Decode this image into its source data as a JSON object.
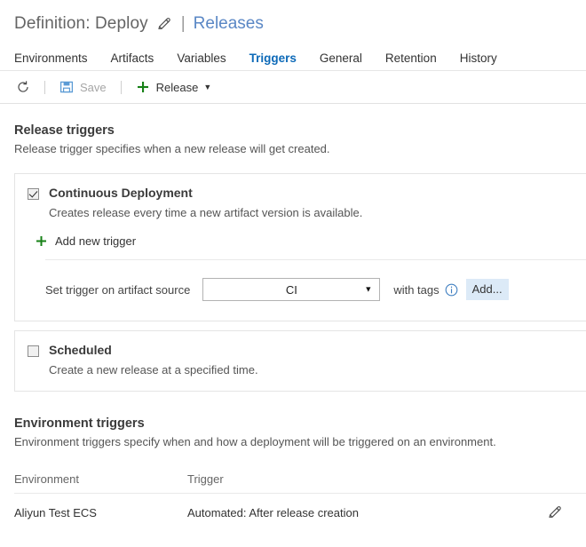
{
  "header": {
    "definition_title": "Definition: Deploy",
    "edit_icon": "pencil-icon",
    "separator": "|",
    "releases_link": "Releases"
  },
  "tabs": [
    {
      "label": "Environments",
      "active": false
    },
    {
      "label": "Artifacts",
      "active": false
    },
    {
      "label": "Variables",
      "active": false
    },
    {
      "label": "Triggers",
      "active": true
    },
    {
      "label": "General",
      "active": false
    },
    {
      "label": "Retention",
      "active": false
    },
    {
      "label": "History",
      "active": false
    }
  ],
  "toolbar": {
    "refresh_icon": "refresh-icon",
    "save_icon": "save-floppy-icon",
    "save_label": "Save",
    "save_disabled": true,
    "release_plus_icon": "plus-icon",
    "release_label": "Release",
    "release_caret": "▼"
  },
  "release_triggers": {
    "title": "Release triggers",
    "subtitle": "Release trigger specifies when a new release will get created.",
    "continuous_deployment": {
      "checked": true,
      "title": "Continuous Deployment",
      "description": "Creates release every time a new artifact version is available.",
      "add_new_trigger_label": "Add new trigger",
      "trigger_row": {
        "label": "Set trigger on artifact source",
        "selected_source": "CI",
        "with_tags_label": "with tags",
        "info_icon": "info-icon",
        "add_button_label": "Add..."
      }
    },
    "scheduled": {
      "checked": false,
      "title": "Scheduled",
      "description": "Create a new release at a specified time."
    }
  },
  "environment_triggers": {
    "title": "Environment triggers",
    "subtitle": "Environment triggers specify when and how a deployment will be triggered on an environment.",
    "columns": [
      "Environment",
      "Trigger"
    ],
    "rows": [
      {
        "environment": "Aliyun Test ECS",
        "trigger": "Automated: After release creation",
        "edit_icon": "pencil-icon"
      }
    ]
  },
  "colors": {
    "accent_blue": "#0d6ab8",
    "link_blue": "#5a87c5",
    "green": "#1a8a1a",
    "save_icon_blue": "#5b9bd5",
    "add_button_bg": "#dceaf7"
  }
}
